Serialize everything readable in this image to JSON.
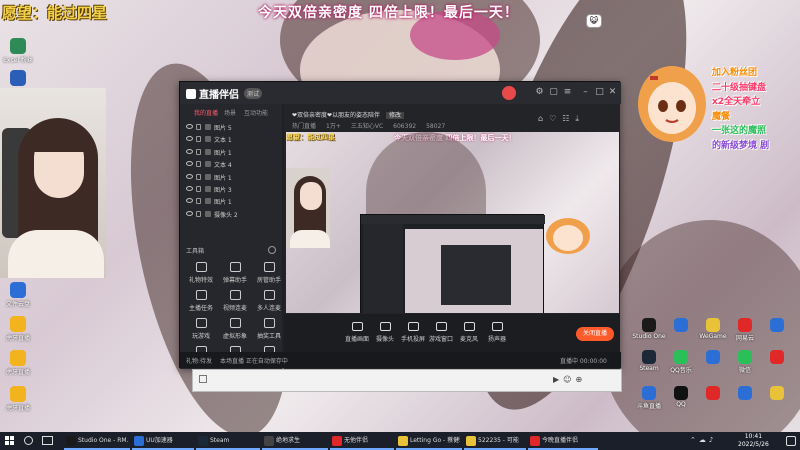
{
  "overlay": {
    "wish": "愿望：能过四星",
    "banner": "今天双倍亲密度 四倍上限！最后一天！"
  },
  "right_list": [
    {
      "text": "加入粉丝团",
      "color": "#ff8a00"
    },
    {
      "text": "二十级抽键盘",
      "color": "#ff3b6b"
    },
    {
      "text": "x2全天牵立",
      "color": "#ff3b6b"
    },
    {
      "text": "魔餐",
      "color": "#ff8a00"
    },
    {
      "text": "一张这的魔照",
      "color": "#2bbf5a"
    },
    {
      "text": "的新级梦境 剧",
      "color": "#8a4bd6"
    }
  ],
  "left_desktop_icons": [
    {
      "label": "Excel 粉丝",
      "color": "#2e8b57"
    },
    {
      "label": "",
      "color": "#2b5fb7"
    },
    {
      "label": "文件云盘",
      "color": "#2b6fd6"
    },
    {
      "label": "虎牙直播",
      "color": "#f2b31f"
    },
    {
      "label": "虎牙直播",
      "color": "#f2b31f"
    },
    {
      "label": "虎牙直播",
      "color": "#f2b31f"
    }
  ],
  "right_desktop_icons": [
    {
      "label": "Studio One",
      "color": "#1a1a1a"
    },
    {
      "label": "",
      "color": "#2b6fd6"
    },
    {
      "label": "WeGame",
      "color": "#e8c33a"
    },
    {
      "label": "网易云",
      "color": "#e02828"
    },
    {
      "label": "",
      "color": "#2b6fd6"
    },
    {
      "label": "Steam",
      "color": "#1b2838"
    },
    {
      "label": "QQ音乐",
      "color": "#2bbf5a"
    },
    {
      "label": "",
      "color": "#2b6fd6"
    },
    {
      "label": "微信",
      "color": "#2bbf5a"
    },
    {
      "label": "",
      "color": "#e02828"
    },
    {
      "label": "斗鱼直播",
      "color": "#2b6fd6"
    },
    {
      "label": "QQ",
      "color": "#111111"
    },
    {
      "label": "",
      "color": "#e02828"
    },
    {
      "label": "",
      "color": "#2b6fd6"
    },
    {
      "label": "",
      "color": "#e8c33a"
    }
  ],
  "app": {
    "logo": "直播伴侣",
    "version": "测试",
    "tabs": [
      "我的直播",
      "场景",
      "互动功能"
    ],
    "layers": [
      {
        "name": "图片 5"
      },
      {
        "name": "文本 1"
      },
      {
        "name": "图片 1"
      },
      {
        "name": "文本 4"
      },
      {
        "name": "图片 1"
      },
      {
        "name": "图片 3"
      },
      {
        "name": "图片 1"
      },
      {
        "name": "摄像头 2"
      }
    ],
    "tools_header": "工具箱",
    "tools": [
      {
        "label": "礼物特效"
      },
      {
        "label": "弹幕助手"
      },
      {
        "label": "房管助手"
      },
      {
        "label": "主播任务"
      },
      {
        "label": "视频连麦"
      },
      {
        "label": "多人连麦"
      },
      {
        "label": "玩游戏"
      },
      {
        "label": "虚拟形象"
      },
      {
        "label": "抽奖工具"
      },
      {
        "label": "拍拍卡"
      },
      {
        "label": "更多功能"
      },
      {
        "label": "直播回放"
      }
    ],
    "preview_header": {
      "title": "❤双倍亲密度❤以朋友的姿态陪伴",
      "edit": "修改",
      "tags": [
        "热门直播",
        "1万+",
        "三五知心VC",
        "606392",
        "58027"
      ]
    },
    "canvas_text": {
      "wish": "愿望：能过四星",
      "banner": "今天双倍亲密度 四倍上限！最后一天！"
    },
    "bottom_buttons": [
      {
        "label": "直播画面"
      },
      {
        "label": "摄像头"
      },
      {
        "label": "手机投屏"
      },
      {
        "label": "游戏窗口"
      },
      {
        "label": "麦克风"
      },
      {
        "label": "扬声器"
      }
    ],
    "live_button": "关闭直播",
    "status": {
      "left": "礼物:待发",
      "mid": "本场直播 正在自动保存中",
      "right": "直播中 00:00:00"
    }
  },
  "taskbar": {
    "items": [
      {
        "label": "Studio One - RM...",
        "color": "#1a1a1a"
      },
      {
        "label": "UU加速器",
        "color": "#2b6fd6"
      },
      {
        "label": "Steam",
        "color": "#1b2838"
      },
      {
        "label": "绝地求生",
        "color": "#444444"
      },
      {
        "label": "无他伴侣",
        "color": "#e02828"
      },
      {
        "label": "Letting Go - 蔡健雅",
        "color": "#e8c33a"
      },
      {
        "label": "522235 - 可能",
        "color": "#e8c33a"
      },
      {
        "label": "今晚直播伴侣",
        "color": "#e02828"
      }
    ],
    "time": "10:41",
    "date": "2022/5/26"
  }
}
